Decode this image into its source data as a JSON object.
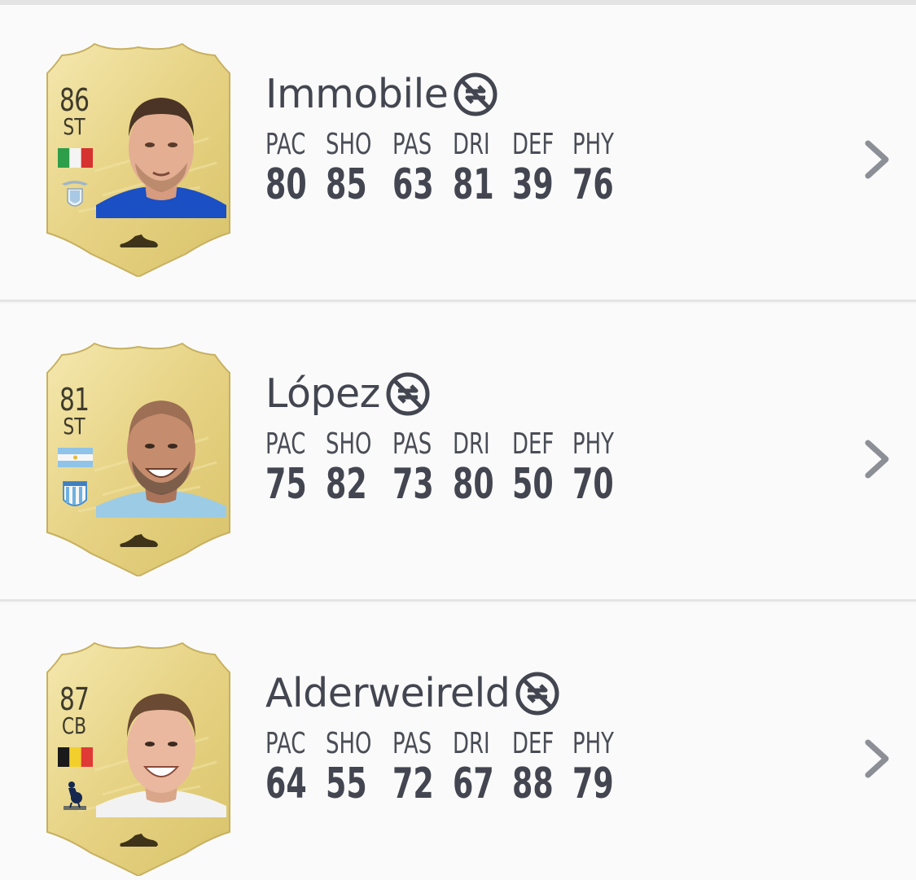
{
  "players": [
    {
      "rating": "86",
      "position": "ST",
      "name": "Immobile",
      "stat_labels": [
        "PAC",
        "SHO",
        "PAS",
        "DRI",
        "DEF",
        "PHY"
      ],
      "stat_values": [
        "80",
        "85",
        "63",
        "81",
        "39",
        "76"
      ],
      "flag": "italy",
      "club": "lazio",
      "kit_color": "#1b4fc4"
    },
    {
      "rating": "81",
      "position": "ST",
      "name": "López",
      "stat_labels": [
        "PAC",
        "SHO",
        "PAS",
        "DRI",
        "DEF",
        "PHY"
      ],
      "stat_values": [
        "75",
        "82",
        "73",
        "80",
        "50",
        "70"
      ],
      "flag": "argentina",
      "club": "racing-club",
      "kit_color": "#9ccbe6"
    },
    {
      "rating": "87",
      "position": "CB",
      "name": "Alderweireld",
      "stat_labels": [
        "PAC",
        "SHO",
        "PAS",
        "DRI",
        "DEF",
        "PHY"
      ],
      "stat_values": [
        "64",
        "55",
        "72",
        "67",
        "88",
        "79"
      ],
      "flag": "belgium",
      "club": "tottenham-hotspur",
      "kit_color": "#f2f2f2"
    }
  ],
  "icons": {
    "untradeable": "untradeable-icon",
    "chevron": "chevron-right-icon",
    "boot": "boot-icon"
  },
  "colors": {
    "card_gold": "#e8d68a",
    "text_dark": "#434650",
    "chevron": "#8c8f96"
  }
}
